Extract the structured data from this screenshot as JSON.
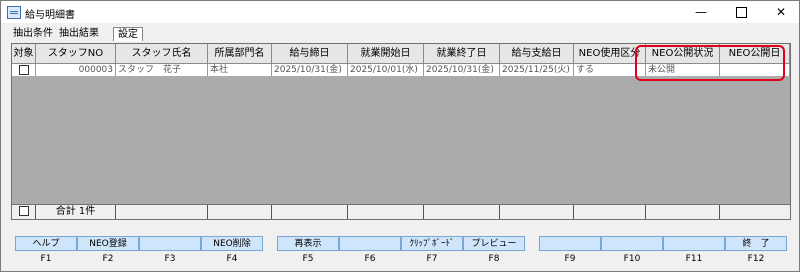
{
  "window": {
    "title": "給与明細書",
    "minimize": "—",
    "close": "✕"
  },
  "tabs": [
    {
      "label": "抽出条件"
    },
    {
      "label": "抽出結果"
    },
    {
      "label": "設定"
    }
  ],
  "table": {
    "columns": [
      "対象",
      "スタッフNO",
      "スタッフ氏名",
      "所属部門名",
      "給与締日",
      "就業開始日",
      "就業終了日",
      "給与支給日",
      "NEO使用区分",
      "NEO公開状況",
      "NEO公開日"
    ],
    "rows": [
      [
        "",
        "000003",
        "スタッフ　花子",
        "本社",
        "2025/10/31(金)",
        "2025/10/01(水)",
        "2025/10/31(金)",
        "2025/11/25(火)",
        "する",
        "未公開",
        ""
      ]
    ],
    "total_label": "合計",
    "total_count": "1件"
  },
  "fkeys": [
    {
      "label": "ヘルプ",
      "key": "F1"
    },
    {
      "label": "NEO登録",
      "key": "F2"
    },
    {
      "label": "",
      "key": "F3"
    },
    {
      "label": "NEO削除",
      "key": "F4"
    },
    {
      "label": "再表示",
      "key": "F5"
    },
    {
      "label": "",
      "key": "F6"
    },
    {
      "label": "ｸﾘｯﾌﾟﾎﾞｰﾄﾞ",
      "key": "F7"
    },
    {
      "label": "プレビュー",
      "key": "F8"
    },
    {
      "label": "",
      "key": "F9"
    },
    {
      "label": "",
      "key": "F10"
    },
    {
      "label": "",
      "key": "F11"
    },
    {
      "label": "終　了",
      "key": "F12"
    }
  ]
}
